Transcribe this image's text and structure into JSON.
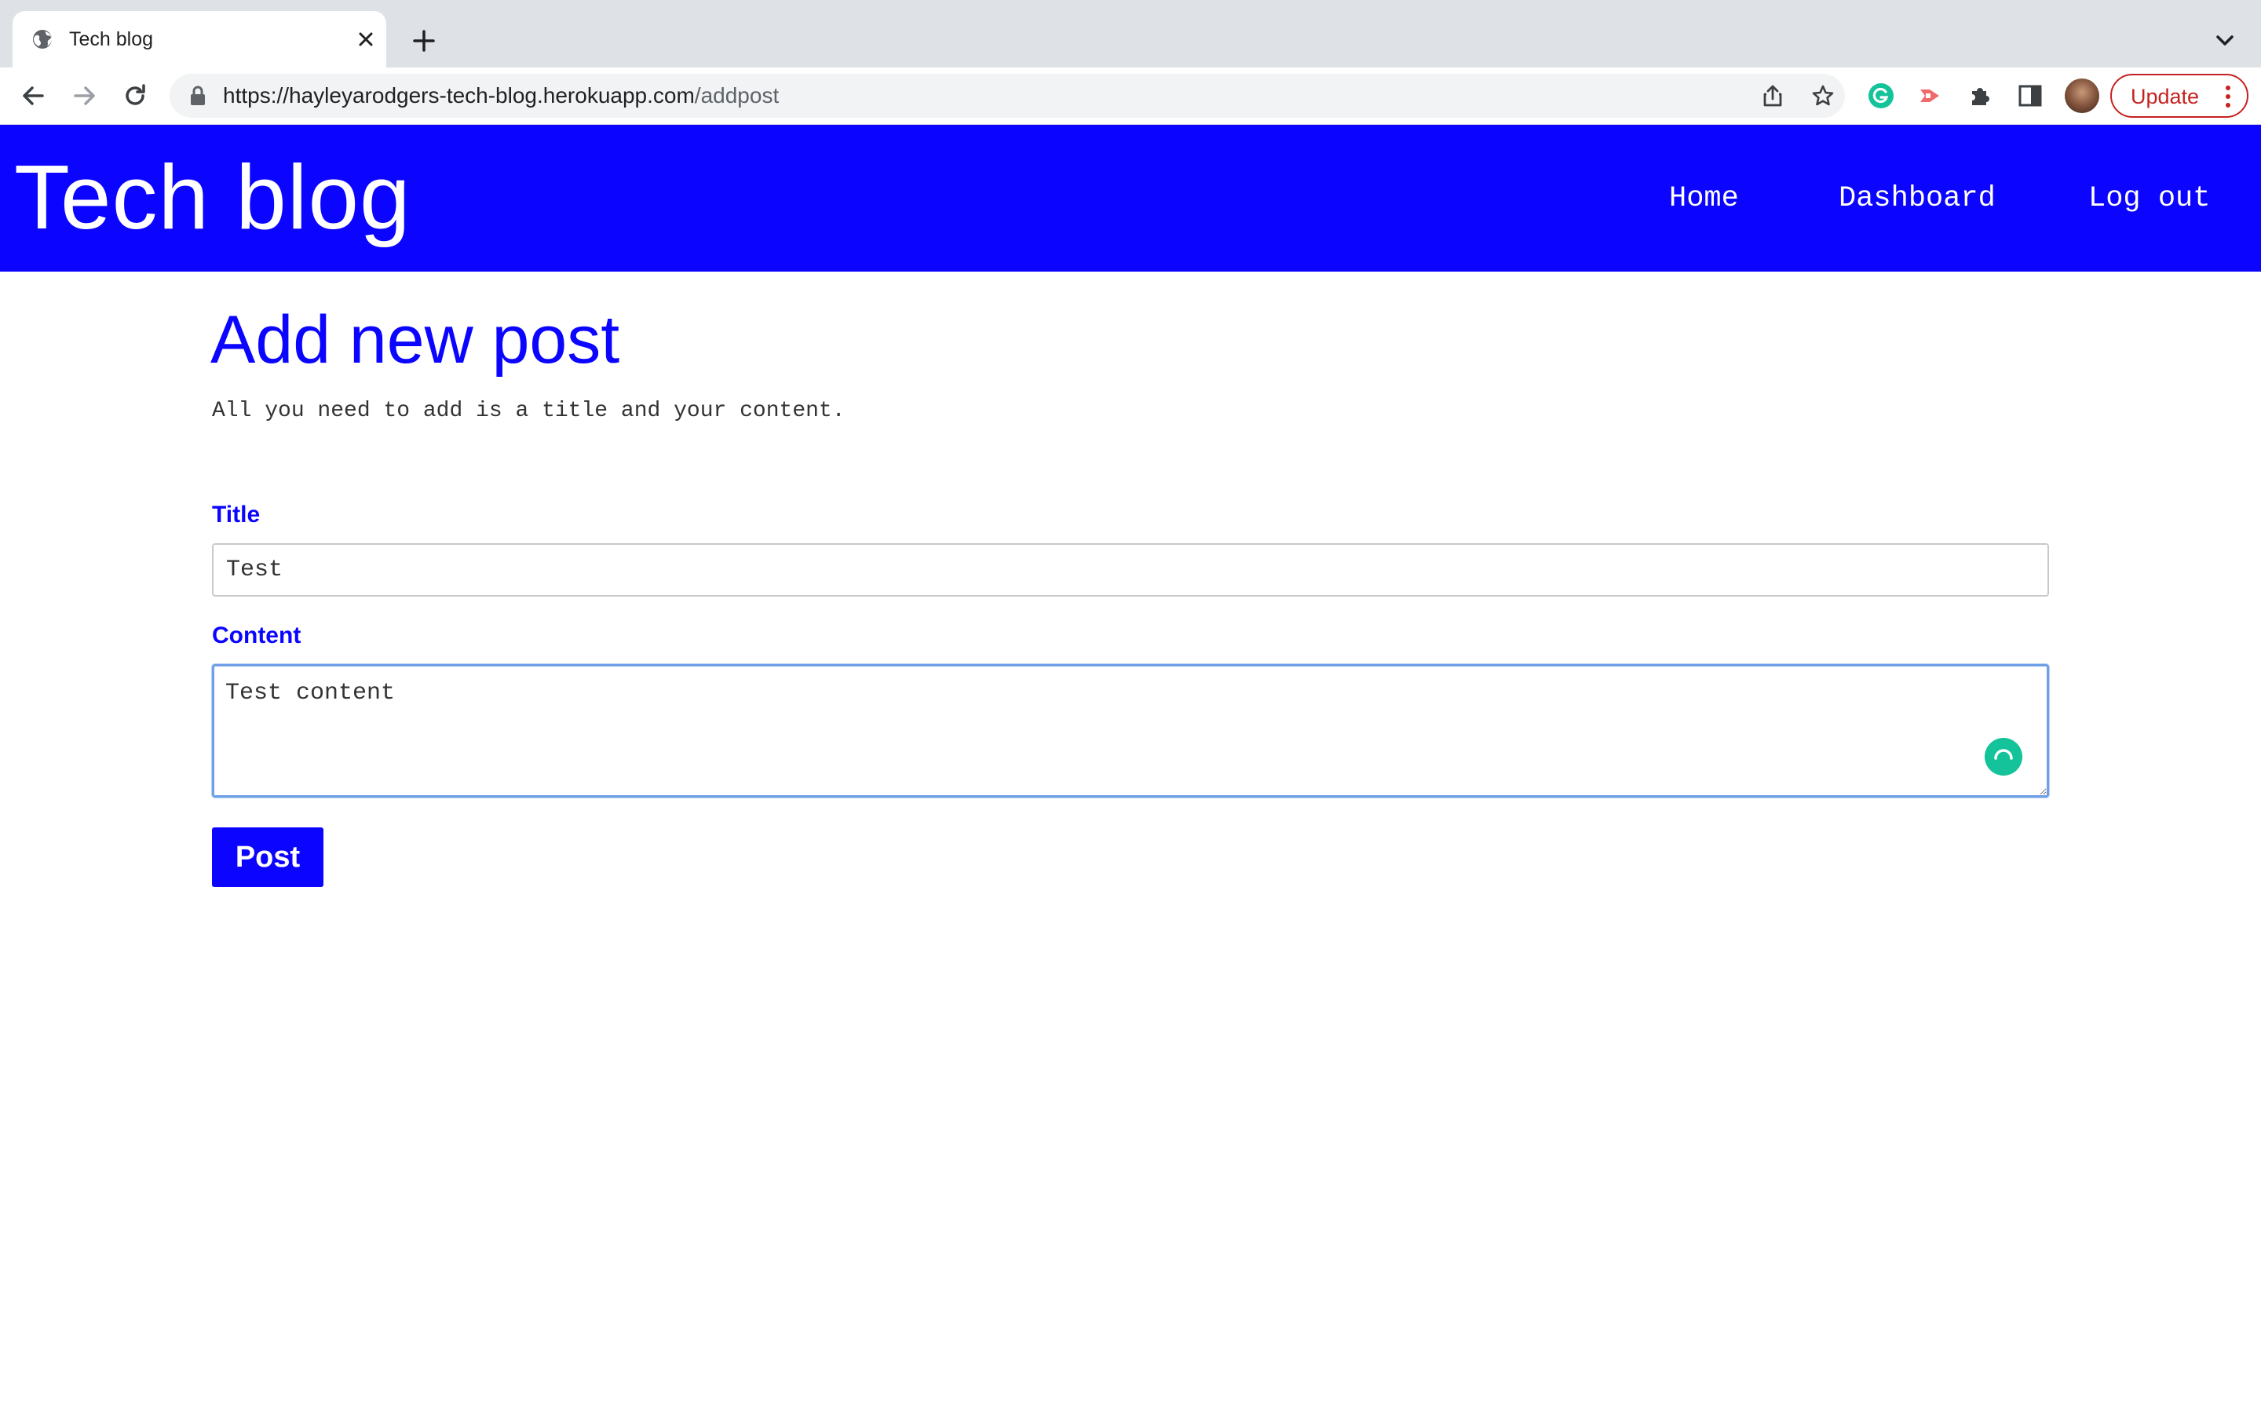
{
  "browser": {
    "tab": {
      "title": "Tech blog",
      "favicon": "globe-icon"
    },
    "address_bar": {
      "url_host": "https://hayleyarodgers-tech-blog.herokuapp.com",
      "url_path": "/addpost"
    },
    "update_button_label": "Update",
    "icons": {
      "back": "back-arrow-icon",
      "forward": "forward-arrow-icon",
      "reload": "reload-icon",
      "share": "share-icon",
      "bookmark": "star-icon",
      "grammarly": "grammarly-icon",
      "extension_red": "red-extension-icon",
      "extensions": "puzzle-icon",
      "side_panel": "side-panel-icon",
      "profile": "avatar",
      "menu": "three-dots-icon"
    },
    "colors": {
      "tabstrip": "#dee1e6",
      "update_accent": "#c5221f"
    }
  },
  "site": {
    "title": "Tech blog",
    "nav": [
      {
        "label": "Home"
      },
      {
        "label": "Dashboard"
      },
      {
        "label": "Log out"
      }
    ],
    "colors": {
      "brand": "#0b04ff",
      "text_on_brand": "#ffffff"
    }
  },
  "form": {
    "heading": "Add new post",
    "subtitle": "All you need to add is a title and your content.",
    "title_label": "Title",
    "title_value": "Test",
    "content_label": "Content",
    "content_value": "Test content",
    "submit_label": "Post"
  }
}
